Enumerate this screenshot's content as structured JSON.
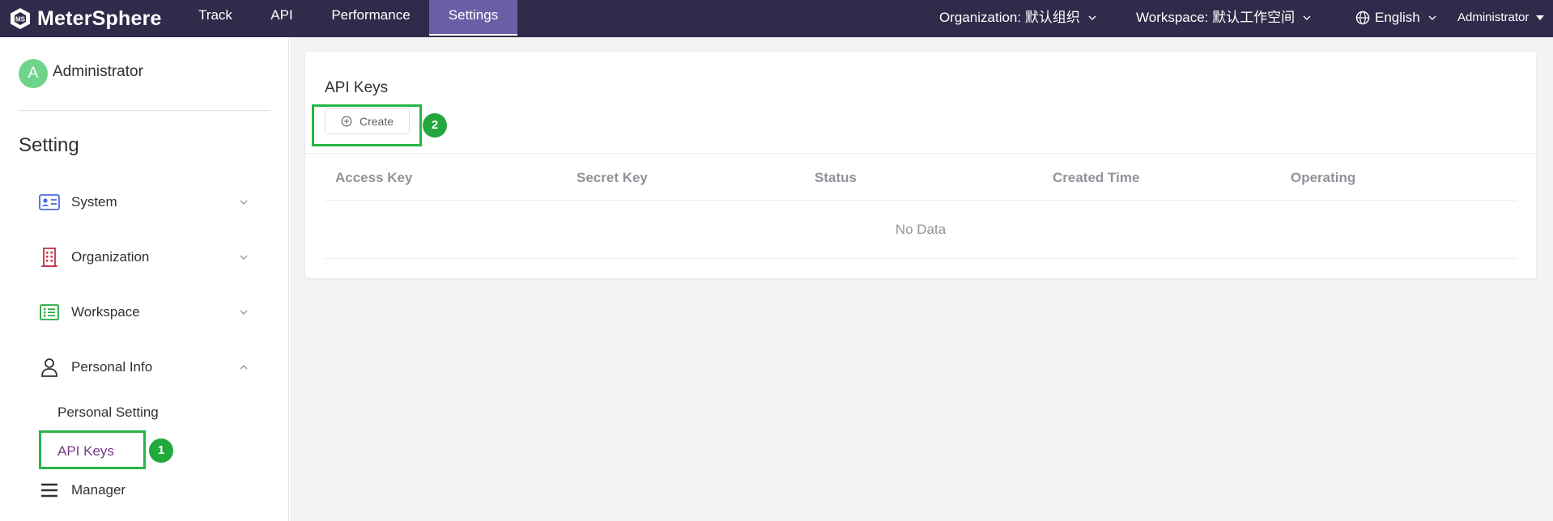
{
  "app": {
    "name": "MeterSphere"
  },
  "nav": {
    "items": [
      {
        "label": "Track"
      },
      {
        "label": "API"
      },
      {
        "label": "Performance"
      },
      {
        "label": "Settings",
        "active": true
      }
    ],
    "organization": "Organization: 默认组织",
    "workspace": "Workspace: 默认工作空间",
    "language": "English",
    "user": "Administrator"
  },
  "sidebar": {
    "avatar_letter": "A",
    "user_name": "Administrator",
    "title": "Setting",
    "menu": [
      {
        "label": "System",
        "icon": "id-card-icon",
        "expanded": false
      },
      {
        "label": "Organization",
        "icon": "building-icon",
        "expanded": false
      },
      {
        "label": "Workspace",
        "icon": "list-icon",
        "expanded": false
      },
      {
        "label": "Personal Info",
        "icon": "person-icon",
        "expanded": true
      },
      {
        "label": "Manager",
        "icon": "menu-lines-icon"
      }
    ],
    "sub_items": [
      {
        "label": "Personal Setting",
        "active": false
      },
      {
        "label": "API Keys",
        "active": true
      }
    ]
  },
  "main": {
    "title": "API Keys",
    "create_label": "Create",
    "table": {
      "columns": [
        "Access Key",
        "Secret Key",
        "Status",
        "Created Time",
        "Operating"
      ],
      "empty_text": "No Data"
    }
  },
  "annotations": {
    "badge1": "1",
    "badge2": "2"
  },
  "colors": {
    "topbar": "#2f2b4a",
    "nav_active": "#6b5ea6",
    "accent_purple": "#783887",
    "highlight_green": "#28b446",
    "avatar": "#6fd48a"
  }
}
